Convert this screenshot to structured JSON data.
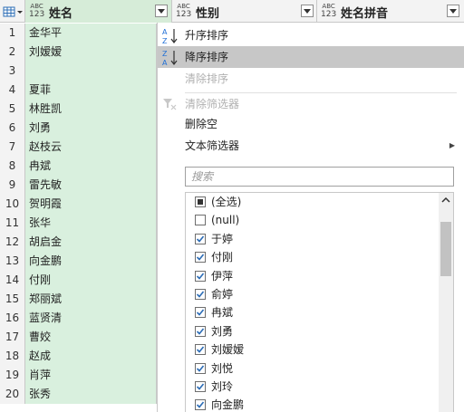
{
  "columns": [
    {
      "type_top": "ABC",
      "type_bottom": "123",
      "title": "姓名"
    },
    {
      "type_top": "ABC",
      "type_bottom": "123",
      "title": "性别"
    },
    {
      "type_top": "ABC",
      "type_bottom": "123",
      "title": "姓名拼音"
    }
  ],
  "rows": [
    {
      "num": "1",
      "name": "金华平"
    },
    {
      "num": "2",
      "name": "刘嫒嫒"
    },
    {
      "num": "3",
      "name": ""
    },
    {
      "num": "4",
      "name": "夏菲"
    },
    {
      "num": "5",
      "name": "林胜凯"
    },
    {
      "num": "6",
      "name": "刘勇"
    },
    {
      "num": "7",
      "name": "赵枝云"
    },
    {
      "num": "8",
      "name": "冉斌"
    },
    {
      "num": "9",
      "name": "雷先敏"
    },
    {
      "num": "10",
      "name": "贺明霞"
    },
    {
      "num": "11",
      "name": "张华"
    },
    {
      "num": "12",
      "name": "胡启金"
    },
    {
      "num": "13",
      "name": "向金鹏"
    },
    {
      "num": "14",
      "name": "付刚"
    },
    {
      "num": "15",
      "name": "郑丽斌"
    },
    {
      "num": "16",
      "name": "蓝贤清"
    },
    {
      "num": "17",
      "name": "曹姣"
    },
    {
      "num": "18",
      "name": "赵成"
    },
    {
      "num": "19",
      "name": "肖萍"
    },
    {
      "num": "20",
      "name": "张秀"
    }
  ],
  "menu": {
    "sort_asc": "升序排序",
    "sort_desc": "降序排序",
    "clear_sort": "清除排序",
    "clear_filter": "清除筛选器",
    "remove_empty": "删除空",
    "text_filters": "文本筛选器",
    "search_placeholder": "搜索"
  },
  "filter_items": [
    {
      "label": "(全选)",
      "state": "partial"
    },
    {
      "label": "(null)",
      "state": "unchecked"
    },
    {
      "label": "于婷",
      "state": "checked"
    },
    {
      "label": "付刚",
      "state": "checked"
    },
    {
      "label": "伊萍",
      "state": "checked"
    },
    {
      "label": "俞婷",
      "state": "checked"
    },
    {
      "label": "冉斌",
      "state": "checked"
    },
    {
      "label": "刘勇",
      "state": "checked"
    },
    {
      "label": "刘嫒嫒",
      "state": "checked"
    },
    {
      "label": "刘悦",
      "state": "checked"
    },
    {
      "label": "刘玲",
      "state": "checked"
    },
    {
      "label": "向金鹏",
      "state": "checked"
    }
  ],
  "colors": {
    "selected_column": "#d9f0de",
    "highlight": "#c7c7c7",
    "accent_blue": "#1f6fd6",
    "check_blue": "#2b6cb6"
  }
}
